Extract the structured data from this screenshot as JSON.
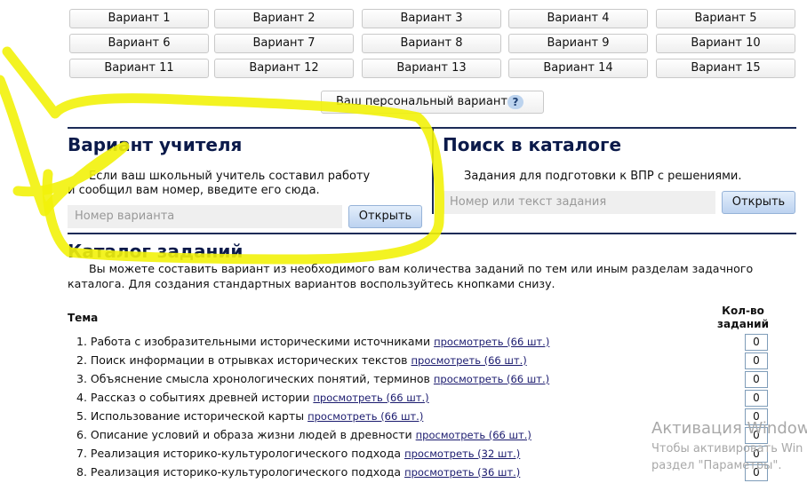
{
  "variants": [
    "Вариант 1",
    "Вариант 2",
    "Вариант 3",
    "Вариант 4",
    "Вариант 5",
    "Вариант 6",
    "Вариант 7",
    "Вариант 8",
    "Вариант 9",
    "Вариант 10",
    "Вариант 11",
    "Вариант 12",
    "Вариант 13",
    "Вариант 14",
    "Вариант 15"
  ],
  "personal": {
    "label": "Ваш персональный вариант",
    "help": "?"
  },
  "teacher": {
    "title": "Вариант учителя",
    "line1": "Если ваш школьный учитель составил работу",
    "line2": "и сообщил вам номер, введите его сюда.",
    "placeholder": "Номер варианта",
    "button": "Открыть"
  },
  "search": {
    "title": "Поиск в каталоге",
    "text": "Задания для подготовки к ВПР с решениями.",
    "placeholder": "Номер или текст задания",
    "button": "Открыть"
  },
  "catalog": {
    "title": "Каталог заданий",
    "line1": "Вы можете составить вариант из необходимого вам количества заданий по тем или иным разделам задачного",
    "line2": "каталога. Для создания стандартных вариантов воспользуйтесь кнопками снизу.",
    "col_topic": "Тема",
    "col_qty1": "Кол-во",
    "col_qty2": "заданий",
    "rows": [
      {
        "text": "1. Работа с изобразительными историческими источниками",
        "link": "просмотреть (66 шт.)",
        "qty": "0"
      },
      {
        "text": "2. Поиск информации в отрывках исторических текстов",
        "link": "просмотреть (66 шт.)",
        "qty": "0"
      },
      {
        "text": "3. Объяснение смысла хронологических понятий, терминов",
        "link": "просмотреть (66 шт.)",
        "qty": "0"
      },
      {
        "text": "4. Рассказ о событиях древней истории",
        "link": "просмотреть (66 шт.)",
        "qty": "0"
      },
      {
        "text": "5. Использование исторической карты",
        "link": "просмотреть (66 шт.)",
        "qty": "0"
      },
      {
        "text": "6. Описание условий и образа жизни людей в древности",
        "link": "просмотреть (66 шт.)",
        "qty": "0"
      },
      {
        "text": "7. Реализация историко-культурологического подхода",
        "link": "просмотреть (32 шт.)",
        "qty": "0"
      },
      {
        "text": "8. Реализация историко-культурологического подхода",
        "link": "просмотреть (36 шт.)",
        "qty": "0"
      }
    ]
  },
  "watermark": {
    "title": "Активация Windows",
    "line1": "Чтобы активировать Win",
    "line2": "раздел \"Параметры\"."
  },
  "colors": {
    "highlight": "#f2f20a",
    "heading": "#0b1a4a",
    "divider": "#1c2b57",
    "button_blue": "#bcd2f0"
  }
}
